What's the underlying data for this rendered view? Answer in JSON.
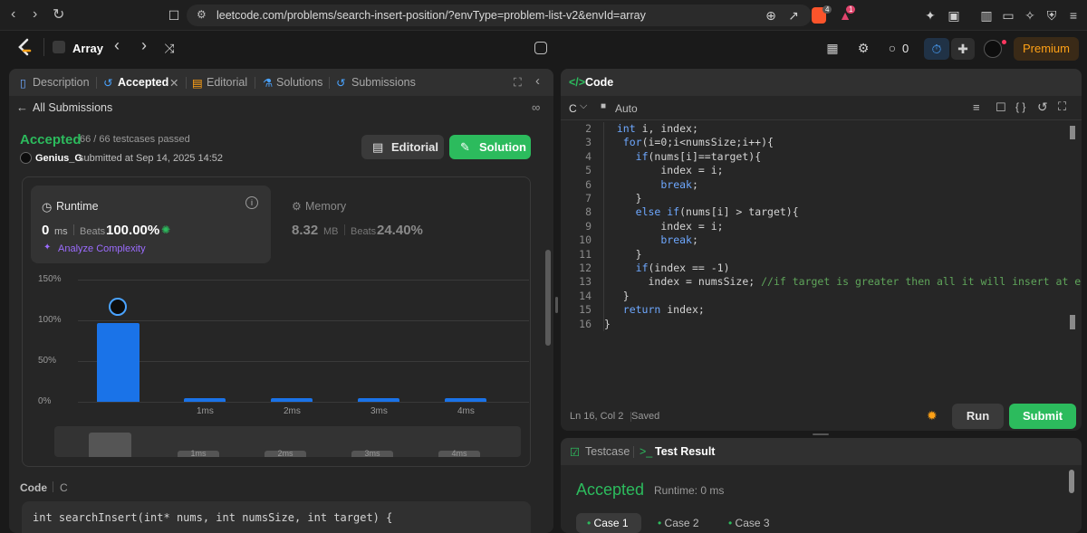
{
  "browser": {
    "url": "leetcode.com/problems/search-insert-position/?envType=problem-list-v2&envId=array",
    "brave_badge": "4",
    "alert_badge": "1"
  },
  "appbar": {
    "list_title": "Array",
    "streak_count": "0",
    "premium_label": "Premium"
  },
  "left_tabs": {
    "description": "Description",
    "accepted": "Accepted",
    "editorial": "Editorial",
    "solutions": "Solutions",
    "submissions": "Submissions"
  },
  "submission": {
    "back_label": "All Submissions",
    "status": "Accepted",
    "testcases": "66 / 66 testcases passed",
    "username": "Genius_G",
    "submitted_at": "submitted at Sep 14, 2025 14:52",
    "editorial_button": "Editorial",
    "solution_button": "Solution"
  },
  "runtime": {
    "label": "Runtime",
    "value": "0",
    "unit": "ms",
    "beats_label": "Beats",
    "beats_value": "100.00%",
    "analyze_label": "Analyze Complexity"
  },
  "memory": {
    "label": "Memory",
    "value": "8.32",
    "unit": "MB",
    "beats_label": "Beats",
    "beats_value": "24.40%"
  },
  "chart_data": {
    "type": "bar",
    "categories": [
      "0ms",
      "1ms",
      "2ms",
      "3ms",
      "4ms"
    ],
    "tick_labels": [
      "",
      "1ms",
      "2ms",
      "3ms",
      "4ms"
    ],
    "values": [
      97,
      4,
      4,
      4,
      4
    ],
    "yticks": [
      "0%",
      "50%",
      "100%",
      "150%"
    ],
    "ylim": [
      0,
      150
    ],
    "highlight_category": "0ms",
    "colors": {
      "bar": "#1a73e8"
    },
    "minimap_labels": [
      "1ms",
      "2ms",
      "3ms",
      "4ms"
    ]
  },
  "code_footer": {
    "label": "Code",
    "language": "C",
    "first_line": "int searchInsert(int* nums, int numsSize, int target) {"
  },
  "editor": {
    "header": "Code",
    "language": "C",
    "auto_label": "Auto",
    "status_pos": "Ln 16, Col 2",
    "status_saved": "Saved",
    "run_label": "Run",
    "submit_label": "Submit",
    "lines": [
      {
        "n": "2",
        "indent": 2,
        "parts": [
          {
            "c": "kw",
            "t": "int"
          },
          {
            "c": "tx",
            "t": " i, index;"
          }
        ]
      },
      {
        "n": "3",
        "indent": 3,
        "parts": [
          {
            "c": "kw",
            "t": "for"
          },
          {
            "c": "tx",
            "t": "(i=0;i<numsSize;i++){"
          }
        ]
      },
      {
        "n": "4",
        "indent": 5,
        "parts": [
          {
            "c": "kw",
            "t": "if"
          },
          {
            "c": "tx",
            "t": "(nums[i]==target){"
          }
        ]
      },
      {
        "n": "5",
        "indent": 9,
        "parts": [
          {
            "c": "tx",
            "t": "index = i;"
          }
        ]
      },
      {
        "n": "6",
        "indent": 9,
        "parts": [
          {
            "c": "kw",
            "t": "break"
          },
          {
            "c": "tx",
            "t": ";"
          }
        ]
      },
      {
        "n": "7",
        "indent": 5,
        "parts": [
          {
            "c": "tx",
            "t": "}"
          }
        ]
      },
      {
        "n": "8",
        "indent": 5,
        "parts": [
          {
            "c": "kw",
            "t": "else if"
          },
          {
            "c": "tx",
            "t": "(nums[i] > target){"
          }
        ]
      },
      {
        "n": "9",
        "indent": 9,
        "parts": [
          {
            "c": "tx",
            "t": "index = i;"
          }
        ]
      },
      {
        "n": "10",
        "indent": 9,
        "parts": [
          {
            "c": "kw",
            "t": "break"
          },
          {
            "c": "tx",
            "t": ";"
          }
        ]
      },
      {
        "n": "11",
        "indent": 5,
        "parts": [
          {
            "c": "tx",
            "t": "}"
          }
        ]
      },
      {
        "n": "12",
        "indent": 5,
        "parts": [
          {
            "c": "kw",
            "t": "if"
          },
          {
            "c": "tx",
            "t": "(index == -1)"
          }
        ]
      },
      {
        "n": "13",
        "indent": 7,
        "parts": [
          {
            "c": "tx",
            "t": "index = numsSize; "
          },
          {
            "c": "cm",
            "t": "//if target is greater then all it will insert at end"
          }
        ]
      },
      {
        "n": "14",
        "indent": 3,
        "parts": [
          {
            "c": "tx",
            "t": "}"
          }
        ]
      },
      {
        "n": "15",
        "indent": 3,
        "parts": [
          {
            "c": "kw",
            "t": "return"
          },
          {
            "c": "tx",
            "t": " index;"
          }
        ]
      },
      {
        "n": "16",
        "indent": 0,
        "parts": [
          {
            "c": "tx",
            "t": "}"
          }
        ]
      }
    ]
  },
  "result_panel": {
    "testcase_tab": "Testcase",
    "result_tab": "Test Result",
    "status": "Accepted",
    "runtime": "Runtime: 0 ms",
    "cases": [
      "Case 1",
      "Case 2",
      "Case 3"
    ]
  }
}
